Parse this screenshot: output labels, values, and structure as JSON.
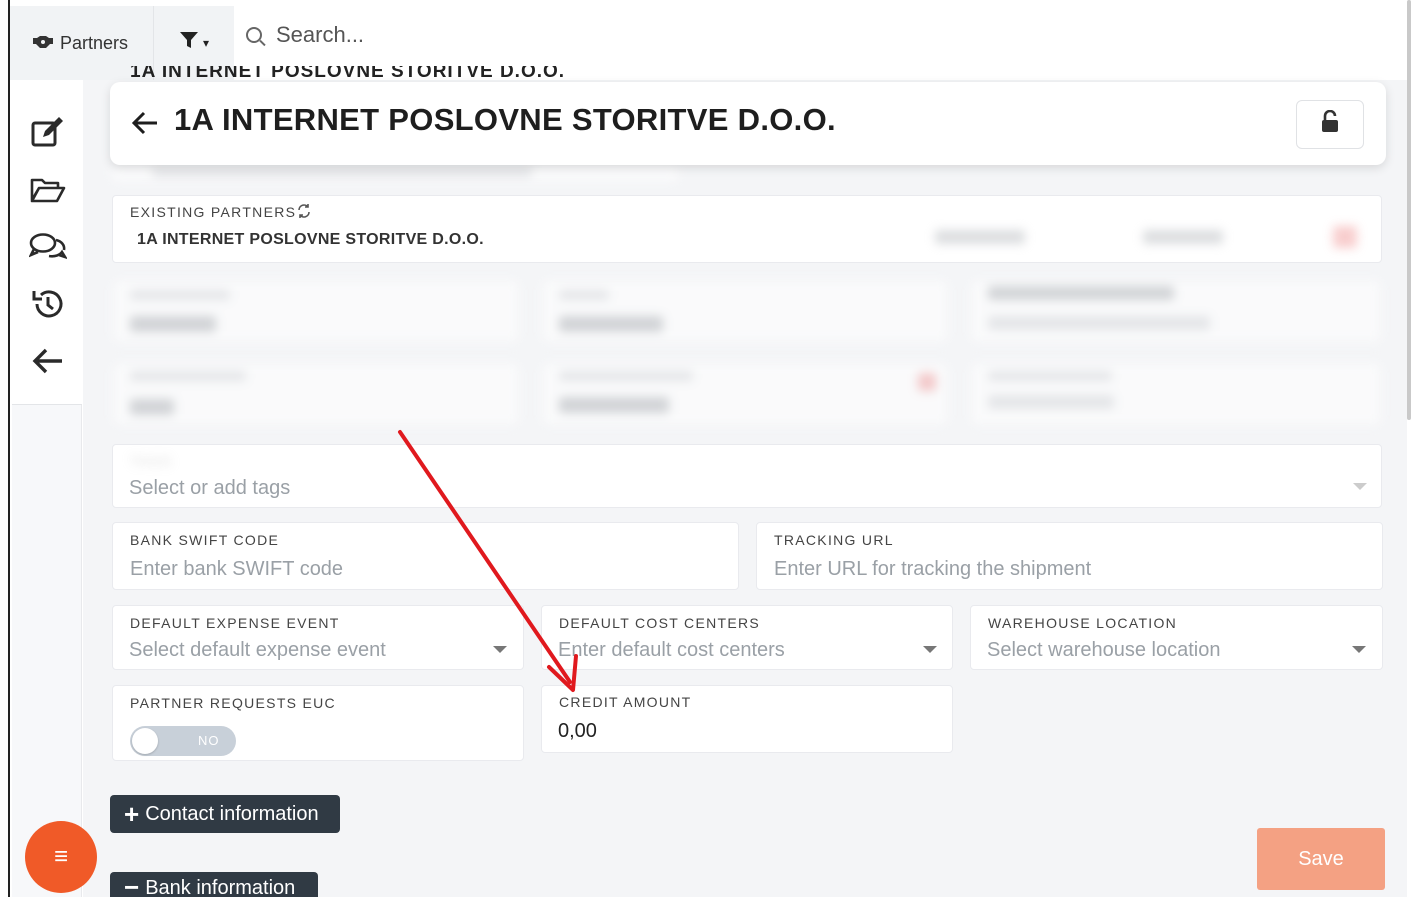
{
  "topbar": {
    "tab_label": "Partners",
    "search_placeholder": "Search..."
  },
  "page": {
    "ghost_title": "1A INTERNET POSLOVNE STORITVE D.O.O.",
    "title": "1A INTERNET POSLOVNE STORITVE D.O.O."
  },
  "existing_partners": {
    "label": "EXISTING PARTNERS",
    "value": "1A INTERNET POSLOVNE STORITVE D.O.O."
  },
  "tags": {
    "label": "TAGS",
    "placeholder": "Select or add tags"
  },
  "fields": {
    "bank_swift": {
      "label": "BANK SWIFT CODE",
      "placeholder": "Enter bank SWIFT code"
    },
    "tracking_url": {
      "label": "TRACKING URL",
      "placeholder": "Enter URL for tracking the shipment"
    },
    "default_expense_event": {
      "label": "DEFAULT EXPENSE EVENT",
      "placeholder": "Select default expense event"
    },
    "default_cost_centers": {
      "label": "DEFAULT COST CENTERS",
      "placeholder": "Enter default cost centers"
    },
    "warehouse_location": {
      "label": "WAREHOUSE LOCATION",
      "placeholder": "Select warehouse location"
    },
    "partner_requests_euc": {
      "label": "PARTNER REQUESTS EUC",
      "toggle_text": "NO"
    },
    "credit_amount": {
      "label": "CREDIT AMOUNT",
      "value": "0,00"
    }
  },
  "buttons": {
    "contact_info": "Contact information",
    "bank_info": "Bank information",
    "save": "Save",
    "fab_symbol": "≡"
  },
  "colors": {
    "accent_orange": "#f05a28",
    "save_disabled": "#f4a183",
    "dark_button": "#303a44",
    "annotation_arrow": "#e0191e"
  }
}
